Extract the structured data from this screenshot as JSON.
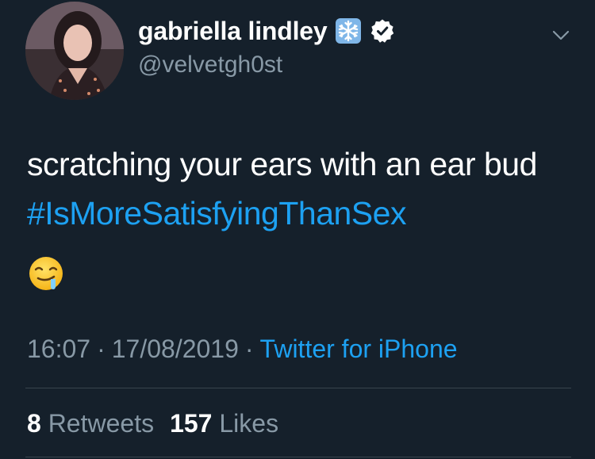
{
  "user": {
    "display_name": "gabriella lindley",
    "handle": "@velvetgh0st",
    "name_emoji_icon": "snowflake-icon",
    "verified_icon": "verified-badge-icon"
  },
  "tweet": {
    "text": "scratching your ears with an ear bud ",
    "hashtag": "#IsMoreSatisfyingThanSex",
    "emoji_icon": "drooling-face-emoji"
  },
  "meta": {
    "time": "16:07",
    "separator": "·",
    "date": "17/08/2019",
    "source": "Twitter for iPhone"
  },
  "stats": {
    "retweets_count": "8",
    "retweets_label": "Retweets",
    "likes_count": "157",
    "likes_label": "Likes"
  },
  "colors": {
    "background": "#15202b",
    "accent": "#1da1f2",
    "secondary_text": "#8899a6",
    "divider": "#38444d"
  }
}
